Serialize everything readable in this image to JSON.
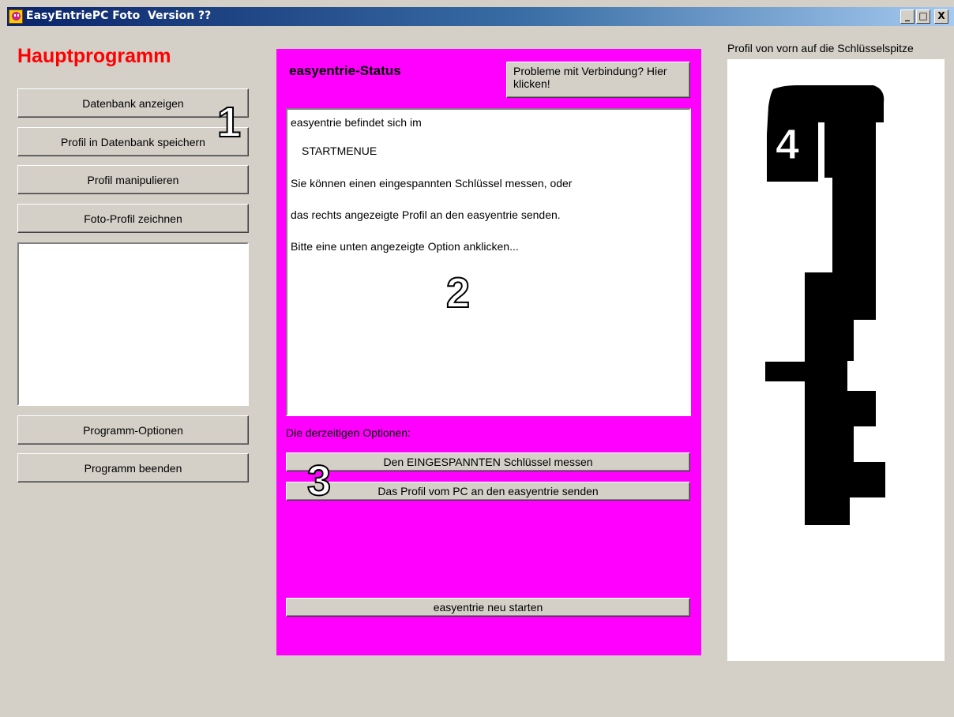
{
  "window": {
    "title": "EasyEntriePC Foto  Version ??",
    "controls": {
      "minimize": "_",
      "maximize": "□",
      "close": "X"
    }
  },
  "left_panel": {
    "heading": "Hauptprogramm",
    "buttons": [
      {
        "label": "Datenbank anzeigen"
      },
      {
        "label": "Profil in Datenbank speichern"
      },
      {
        "label": "Profil manipulieren"
      },
      {
        "label": "Foto-Profil zeichnen"
      }
    ],
    "bottom_buttons": [
      {
        "label": "Programm-Optionen"
      },
      {
        "label": "Programm beenden"
      }
    ]
  },
  "status_panel": {
    "title": "easyentrie-Status",
    "problem_button": "Probleme mit Verbindung? Hier klicken!",
    "lines": [
      "easyentrie befindet sich im",
      "STARTMENUE",
      "Sie können einen eingespannten Schlüssel messen, oder",
      "das rechts angezeigte Profil an den easyentrie senden.",
      "Bitte eine unten angezeigte Option anklicken..."
    ],
    "options_label": "Die derzeitigen Optionen:",
    "option_buttons": [
      {
        "label": "Den EINGESPANNTEN Schlüssel messen"
      },
      {
        "label": "Das Profil vom PC an den easyentrie senden"
      }
    ],
    "restart_button": "easyentrie neu starten",
    "accent_color": "#ff00ff"
  },
  "profile_panel": {
    "label": "Profil von vorn auf die Schlüsselspitze"
  },
  "annotations": [
    "1",
    "2",
    "3",
    "4"
  ]
}
